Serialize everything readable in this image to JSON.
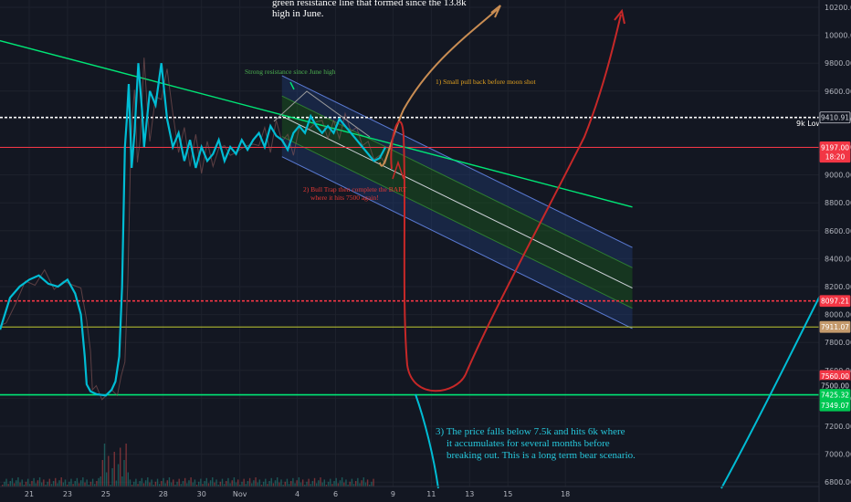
{
  "chart_data": {
    "type": "line",
    "title": "",
    "xlabel": "",
    "ylabel": "",
    "y_range": [
      6800,
      10250
    ],
    "y_ticks": [
      6800,
      7000,
      7200,
      7400,
      7600,
      7800,
      8000,
      8200,
      8400,
      8600,
      8800,
      9000,
      9200,
      9400,
      9600,
      9800,
      10000,
      10200
    ],
    "y_tick_labels": [
      "6800.00",
      "7000.00",
      "7200.00",
      "7400.00",
      "7600.00",
      "7800.00",
      "8000.00",
      "8200.00",
      "8400.00",
      "8600.00",
      "8800.00",
      "9000.00",
      "9200.00",
      "9400.00",
      "9600.00",
      "9800.00",
      "10000.00",
      "10200.00"
    ],
    "x_ticks": [
      {
        "label": "21",
        "day": 21
      },
      {
        "label": "23",
        "day": 23
      },
      {
        "label": "25",
        "day": 25
      },
      {
        "label": "28",
        "day": 28
      },
      {
        "label": "30",
        "day": 30
      },
      {
        "label": "Nov",
        "day": 32
      },
      {
        "label": "4",
        "day": 35
      },
      {
        "label": "6",
        "day": 37
      },
      {
        "label": "9",
        "day": 40
      },
      {
        "label": "11",
        "day": 42
      },
      {
        "label": "13",
        "day": 44
      },
      {
        "label": "15",
        "day": 46
      },
      {
        "label": "18",
        "day": 49
      }
    ],
    "price_series": {
      "name": "",
      "color": "#00bcd4",
      "points": [
        [
          19.0,
          7950
        ],
        [
          19.5,
          7900
        ],
        [
          20.0,
          8120
        ],
        [
          20.5,
          8200
        ],
        [
          21.0,
          8250
        ],
        [
          21.5,
          8280
        ],
        [
          22.0,
          8220
        ],
        [
          22.5,
          8200
        ],
        [
          23.0,
          8250
        ],
        [
          23.4,
          8150
        ],
        [
          23.7,
          8000
        ],
        [
          23.9,
          7700
        ],
        [
          24.0,
          7500
        ],
        [
          24.2,
          7450
        ],
        [
          24.5,
          7430
        ],
        [
          25.0,
          7420
        ],
        [
          25.3,
          7460
        ],
        [
          25.5,
          7520
        ],
        [
          25.7,
          7700
        ],
        [
          25.85,
          8200
        ],
        [
          26.0,
          9200
        ],
        [
          26.1,
          9400
        ],
        [
          26.2,
          9650
        ],
        [
          26.35,
          9050
        ],
        [
          26.5,
          9300
        ],
        [
          26.7,
          9800
        ],
        [
          26.9,
          9450
        ],
        [
          27.0,
          9200
        ],
        [
          27.3,
          9600
        ],
        [
          27.6,
          9500
        ],
        [
          27.9,
          9800
        ],
        [
          28.2,
          9400
        ],
        [
          28.5,
          9200
        ],
        [
          28.8,
          9300
        ],
        [
          29.1,
          9100
        ],
        [
          29.4,
          9250
        ],
        [
          29.7,
          9050
        ],
        [
          30.0,
          9200
        ],
        [
          30.3,
          9100
        ],
        [
          30.6,
          9150
        ],
        [
          30.9,
          9250
        ],
        [
          31.2,
          9100
        ],
        [
          31.5,
          9200
        ],
        [
          31.8,
          9150
        ],
        [
          32.1,
          9250
        ],
        [
          32.4,
          9180
        ],
        [
          32.7,
          9250
        ],
        [
          33.0,
          9300
        ],
        [
          33.3,
          9200
        ],
        [
          33.6,
          9350
        ],
        [
          33.9,
          9280
        ],
        [
          34.2,
          9250
        ],
        [
          34.5,
          9180
        ],
        [
          34.8,
          9300
        ],
        [
          35.1,
          9350
        ],
        [
          35.4,
          9300
        ],
        [
          35.7,
          9420
        ],
        [
          36.0,
          9350
        ],
        [
          36.3,
          9300
        ],
        [
          36.6,
          9350
        ],
        [
          36.9,
          9300
        ],
        [
          37.2,
          9400
        ],
        [
          37.5,
          9350
        ],
        [
          37.8,
          9300
        ],
        [
          38.1,
          9250
        ],
        [
          38.4,
          9200
        ],
        [
          38.7,
          9150
        ],
        [
          39.0,
          9100
        ],
        [
          39.3,
          9120
        ],
        [
          39.6,
          9197
        ]
      ]
    },
    "price_axis_tags": [
      {
        "label": "9410.91",
        "value": 9410.91,
        "bg": "#131722",
        "fg": "#d1d4dc",
        "border": "#d1d4dc"
      },
      {
        "label": "9197.00",
        "value": 9197.0,
        "bg": "#f23645",
        "fg": "#ffffff",
        "border": "#f23645"
      },
      {
        "label": "18:20",
        "value": 9130,
        "bg": "#f23645",
        "fg": "#ffffff",
        "border": "#f23645"
      },
      {
        "label": "8097.21",
        "value": 8097.21,
        "bg": "#f23645",
        "fg": "#ffffff",
        "border": "#f23645"
      },
      {
        "label": "7911.07",
        "value": 7911.07,
        "bg": "#c49a6c",
        "fg": "#ffffff",
        "border": "#c49a6c"
      },
      {
        "label": "7560.00",
        "value": 7560.0,
        "bg": "#f23645",
        "fg": "#ffffff",
        "border": "#f23645"
      },
      {
        "label": "7500.00",
        "value": 7490.0,
        "bg": "#131722",
        "fg": "#d1d4dc",
        "border": "#131722"
      },
      {
        "label": "7425.32",
        "value": 7425.32,
        "bg": "#00c853",
        "fg": "#ffffff",
        "border": "#00c853"
      },
      {
        "label": "7349.07",
        "value": 7349.07,
        "bg": "#00c853",
        "fg": "#ffffff",
        "border": "#00c853"
      }
    ],
    "horizontal_levels": [
      {
        "value": 9410.91,
        "color": "#ffffff",
        "style": "dotted",
        "label": "9k Low"
      },
      {
        "value": 9197.0,
        "color": "#f23645",
        "style": "thin"
      },
      {
        "value": 8097.21,
        "color": "#f23645",
        "style": "dotted"
      },
      {
        "value": 7911.07,
        "color": "#c0c830",
        "style": "thin"
      },
      {
        "value": 7425.32,
        "color": "#00e676",
        "style": "solid"
      }
    ],
    "resistance_line": {
      "from": [
        17.0,
        10050
      ],
      "to": [
        52.5,
        8770
      ],
      "color": "#00e676"
    },
    "regression_channel": {
      "center_from": [
        34.2,
        9420
      ],
      "center_to": [
        52.5,
        8190
      ],
      "inner_offset": 145,
      "outer_offset": 290,
      "inner_color": "#1b5e20",
      "outer_color": "#1e3a6e",
      "center_color": "#d1d4dc"
    },
    "annotations": {
      "top_text_line1": "green resistance line that formed since the 13.8k",
      "top_text_line2": "high in June.",
      "resistance_label": "Strong resistance since June high",
      "scenario1": "1) Small pull back before moon shot",
      "scenario2_line1": "2) Bull Trap then complete the BART",
      "scenario2_line2": "where it hits 7500 again!",
      "scenario3_line1": "3) The price falls below 7.5k and hits 6k where",
      "scenario3_line2": "it accumulates for several months before",
      "scenario3_line3": "breaking out. This is a long term bear scenario.",
      "level_label": "9k Low"
    },
    "colors": {
      "background": "#131722",
      "price": "#00bcd4",
      "scenario1": "#c98d53",
      "scenario2": "#c62828",
      "scenario3": "#00bcd4",
      "resistance": "#00e676"
    }
  }
}
